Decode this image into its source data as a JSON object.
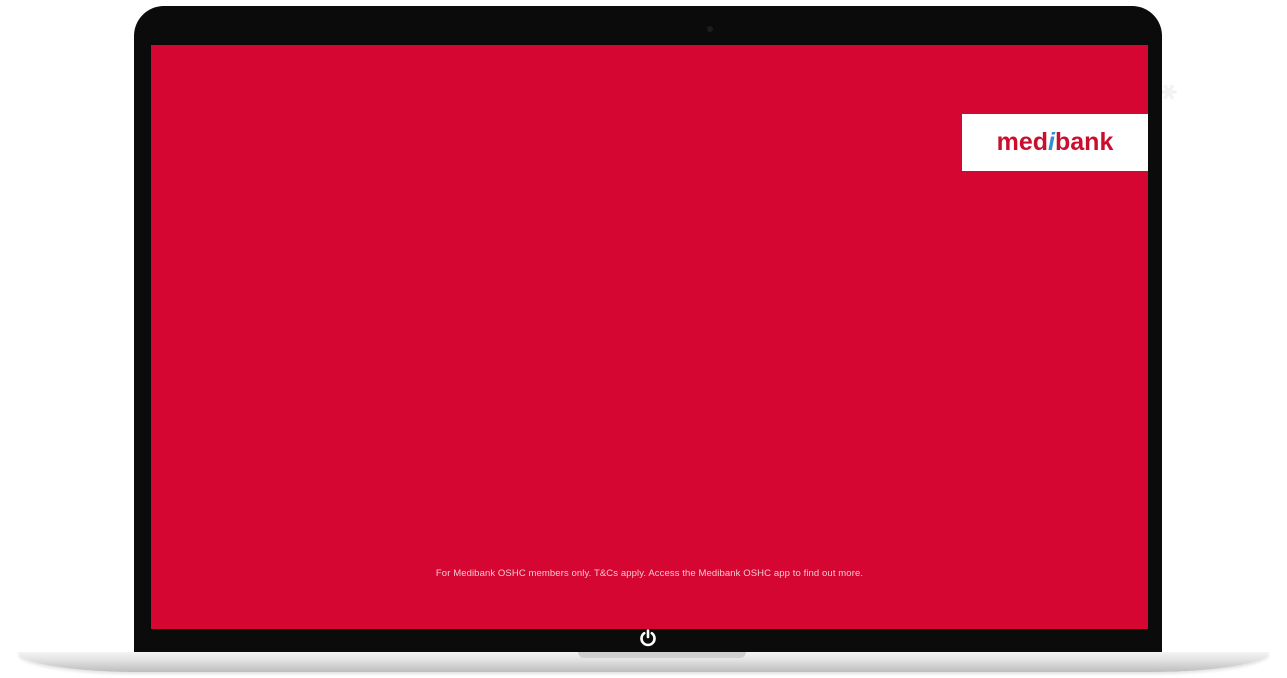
{
  "brand": {
    "logo_part_1": "med",
    "logo_i": "i",
    "logo_part_2": "bank"
  },
  "screen": {
    "background_color": "#d50632",
    "disclaimer": "For Medibank OSHC members only. T&Cs apply. Access the Medibank OSHC app to find out more."
  },
  "device": {
    "power_icon": "power-icon"
  }
}
